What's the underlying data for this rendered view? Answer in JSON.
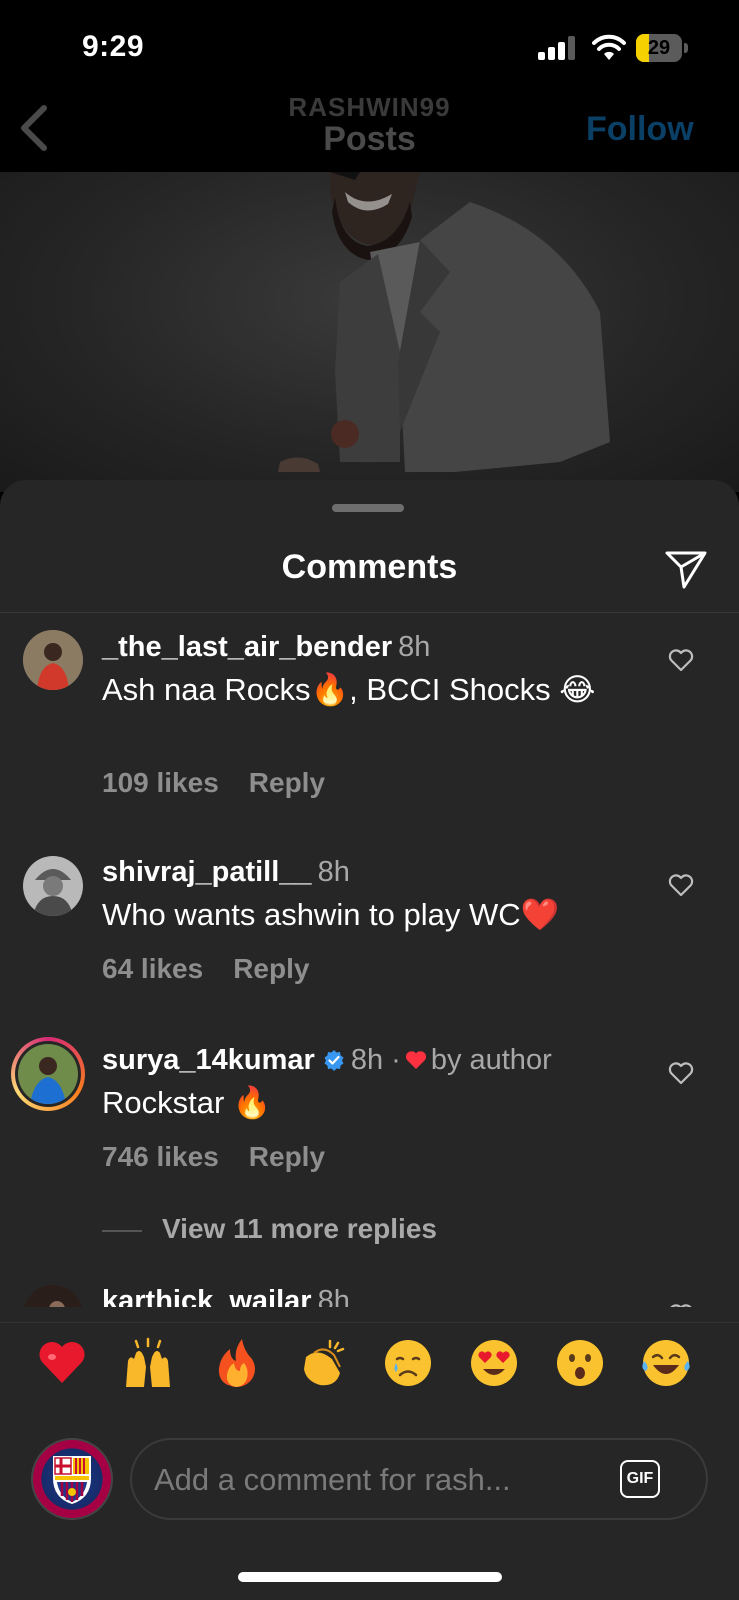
{
  "status_bar": {
    "time": "9:29",
    "battery_level": "29",
    "battery_fraction": 0.29
  },
  "header": {
    "username": "RASHWIN99",
    "title": "Posts",
    "follow_label": "Follow",
    "follow_color": "#0a3f66"
  },
  "sheet": {
    "title": "Comments"
  },
  "comments": [
    {
      "username": "_the_last_air_bender",
      "time": "8h",
      "text": "Ash naa Rocks🔥, BCCI Shocks 😂",
      "likes": "109 likes",
      "reply": "Reply"
    },
    {
      "username": "shivraj_patill__",
      "time": "8h",
      "text": "Who wants ashwin to play WC❤️",
      "likes": "64 likes",
      "reply": "Reply"
    },
    {
      "username": "surya_14kumar",
      "verified": true,
      "time": "8h ·",
      "liked_by_author": "by author",
      "text": "Rockstar 🔥",
      "likes": "746 likes",
      "reply": "Reply",
      "view_replies": "View 11 more replies"
    },
    {
      "username": "karthick_wailar",
      "time": "8h"
    }
  ],
  "emoji_bar": [
    "❤️",
    "🙌",
    "🔥",
    "👏",
    "😢",
    "😍",
    "😮",
    "😂"
  ],
  "input": {
    "placeholder": "Add a comment for rash...",
    "gif_label": "GIF"
  },
  "colors": {
    "sheet_bg": "#262626",
    "verified_blue": "#3897f0",
    "heart_red": "#ff3040"
  }
}
